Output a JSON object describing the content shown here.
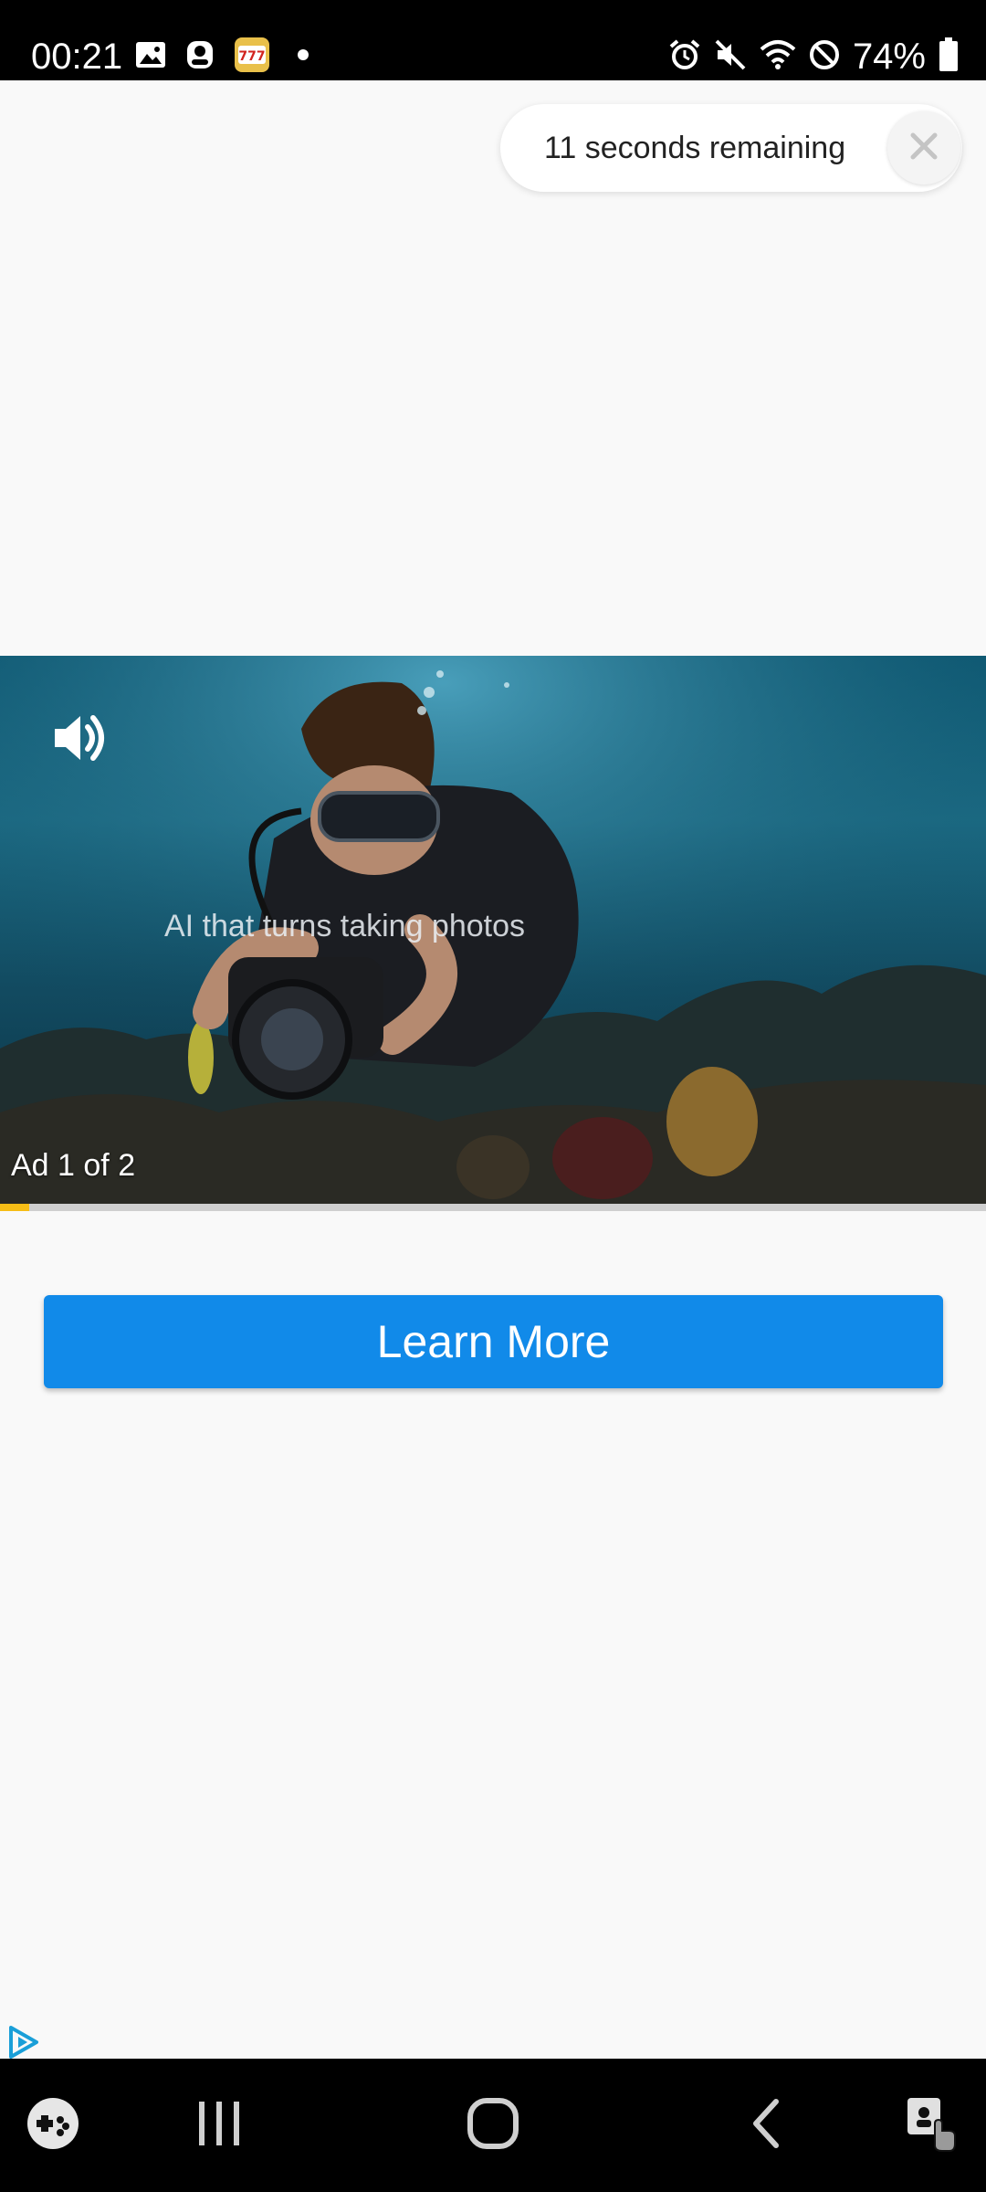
{
  "status_bar": {
    "time": "00:21",
    "battery": "74%",
    "left_icons": [
      "gallery-icon",
      "profile-icon",
      "slots-app-icon",
      "notification-dot"
    ],
    "right_icons": [
      "alarm-icon",
      "mute-icon",
      "wifi-icon",
      "do-not-disturb-icon",
      "battery-icon"
    ]
  },
  "countdown": {
    "text": "11 seconds remaining",
    "close_icon": "close-icon"
  },
  "video": {
    "caption": "AI that turns taking photos",
    "ad_counter": "Ad 1 of 2",
    "volume_icon": "volume-icon",
    "progress": 0.03,
    "progress_color": "#f6bd16"
  },
  "cta": {
    "label": "Learn More",
    "color": "#118ae9"
  },
  "ad_choices_icon": "ad-choices-icon",
  "nav_bar": {
    "items": [
      "game-launcher-icon",
      "recent-apps-icon",
      "home-icon",
      "back-icon",
      "accessibility-icon"
    ]
  }
}
